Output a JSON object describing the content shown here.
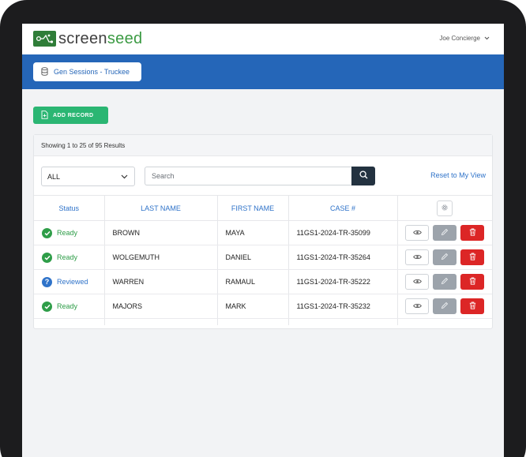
{
  "brand": {
    "part1": "screen",
    "part2": "seed"
  },
  "user_menu": {
    "name": "Joe Concierge"
  },
  "session": {
    "label": "Gen Sessions - Truckee"
  },
  "toolbar": {
    "add_record_label": "ADD RECORD"
  },
  "results": {
    "summary": "Showing 1 to 25 of 95 Results"
  },
  "filter": {
    "selected": "ALL"
  },
  "search": {
    "placeholder": "Search"
  },
  "reset_link": "Reset to My View",
  "table": {
    "headers": {
      "status": "Status",
      "last_name": "LAST NAME",
      "first_name": "FIRST NAME",
      "case": "CASE #"
    },
    "rows": [
      {
        "status": "Ready",
        "last": "BROWN",
        "first": "MAYA",
        "case": "11GS1-2024-TR-35099"
      },
      {
        "status": "Ready",
        "last": "WOLGEMUTH",
        "first": "DANIEL",
        "case": "11GS1-2024-TR-35264"
      },
      {
        "status": "Reviewed",
        "last": "WARREN",
        "first": "RAMAUL",
        "case": "11GS1-2024-TR-35222"
      },
      {
        "status": "Ready",
        "last": "MAJORS",
        "first": "MARK",
        "case": "11GS1-2024-TR-35232"
      }
    ]
  },
  "colors": {
    "brand_green": "#3b9a43",
    "header_blue": "#2566b8",
    "add_green": "#2bb673",
    "ready_green": "#2e9d48",
    "reviewed_blue": "#2f73c9",
    "delete_red": "#dc2626",
    "edit_gray": "#9ca3ab"
  },
  "icons": {
    "logo": "circuit-logo-icon",
    "session": "database-icon",
    "add": "document-plus-icon",
    "select": "chevron-down-icon",
    "search": "search-icon",
    "settings": "gear-icon",
    "view": "eye-icon",
    "edit": "pencil-icon",
    "delete": "trash-icon",
    "ready": "check-circle-icon",
    "reviewed": "question-circle-icon"
  }
}
